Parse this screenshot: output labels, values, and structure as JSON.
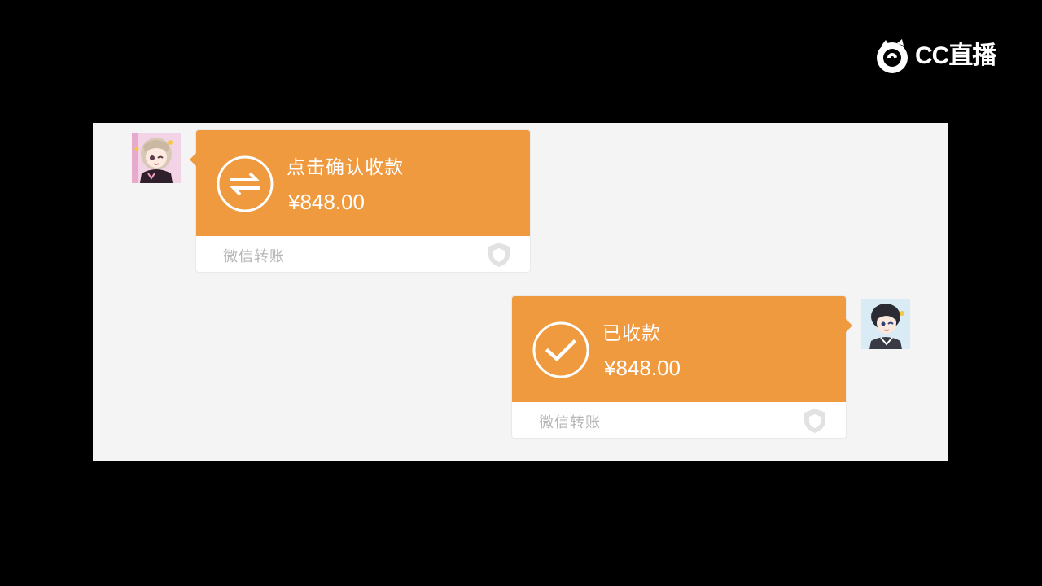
{
  "watermark": {
    "text": "CC直播",
    "icon": "cc-live-logo-icon"
  },
  "colors": {
    "transfer_orange": "#f09a40",
    "panel_background": "#f4f4f4",
    "label_gray": "#b5b5b5"
  },
  "messages": [
    {
      "side": "left",
      "status": "点击确认收款",
      "amount": "¥848.00",
      "source": "微信转账",
      "icon": "transfer-arrows-icon",
      "avatar": "sender-avatar"
    },
    {
      "side": "right",
      "status": "已收款",
      "amount": "¥848.00",
      "source": "微信转账",
      "icon": "checkmark-icon",
      "avatar": "receiver-avatar"
    }
  ]
}
